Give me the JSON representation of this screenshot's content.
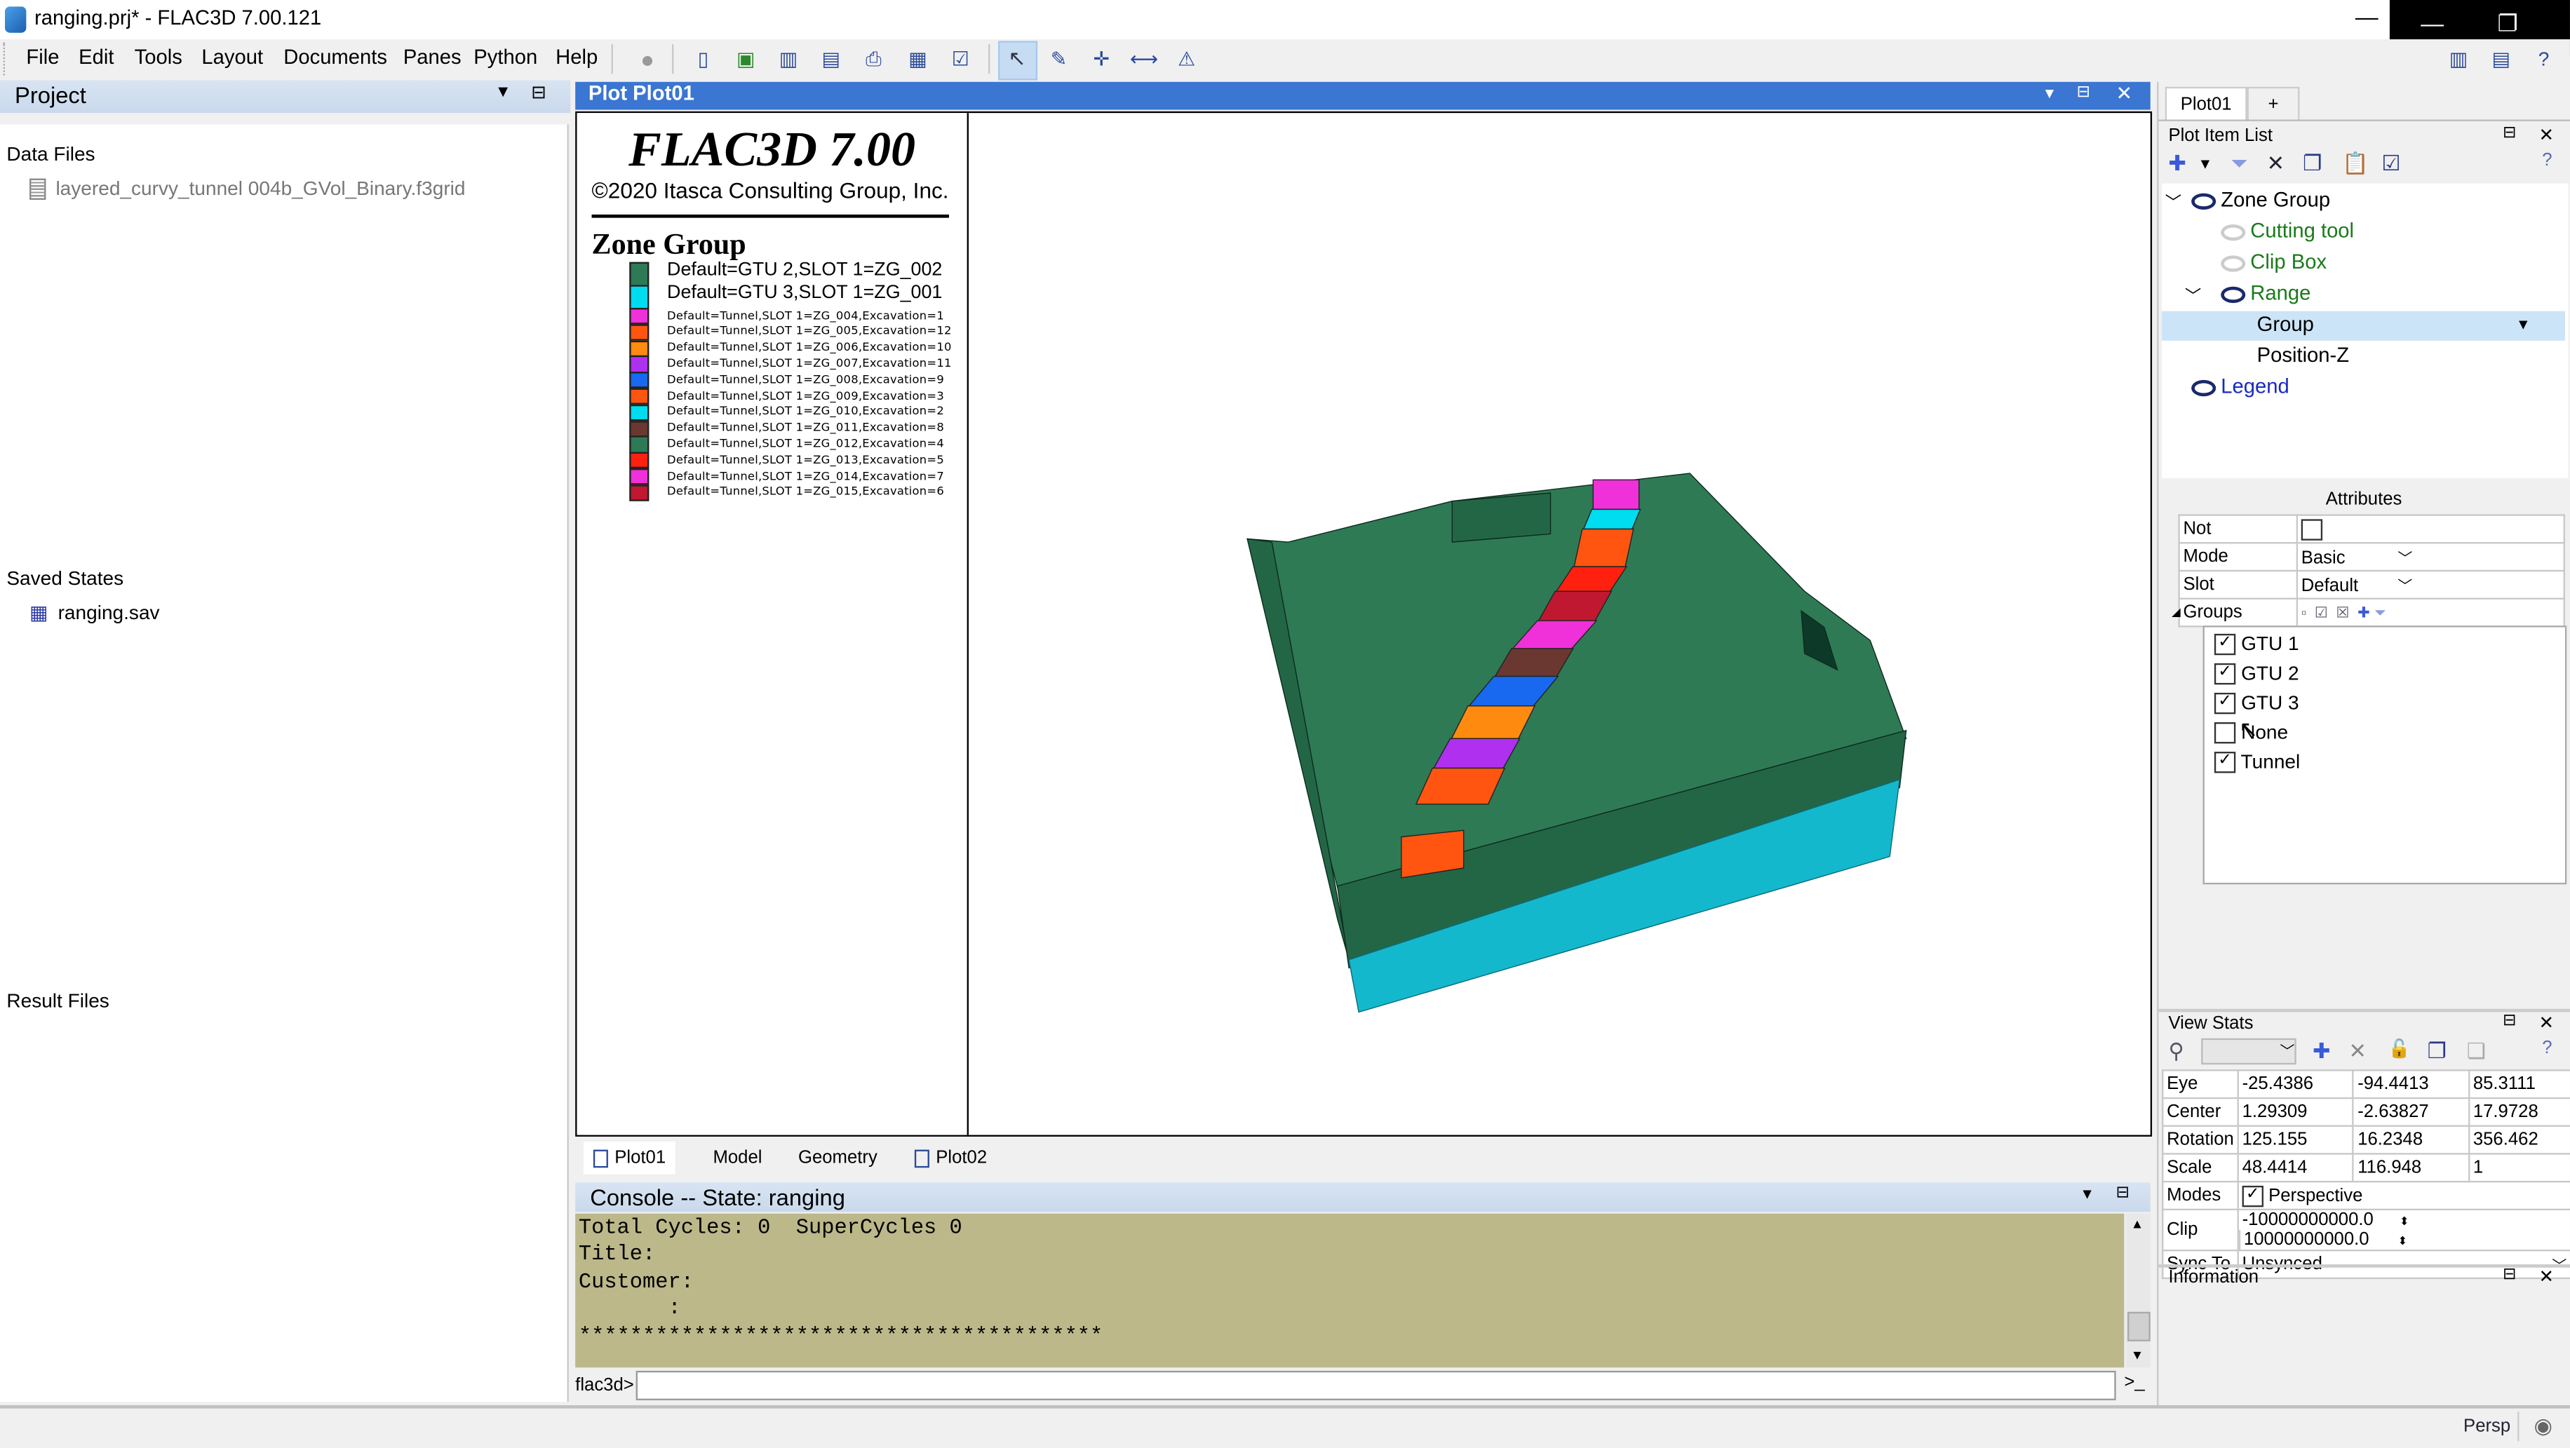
{
  "window": {
    "title": "ranging.prj* - FLAC3D 7.00.121",
    "controls": {
      "minimize": "—",
      "minimize_dark": "—",
      "restore": "❐"
    }
  },
  "menu": [
    "File",
    "Edit",
    "Tools",
    "Layout",
    "Documents",
    "Panes",
    "Python",
    "Help"
  ],
  "toolbar": {
    "icons": [
      "record-icon",
      "plot-new-icon",
      "plot-refresh-icon",
      "plot-save-icon",
      "plot-export-icon",
      "print-icon",
      "plot-dropdown-icon",
      "plot-check-icon",
      "select-pointer-icon",
      "pick-icon",
      "crosshair-icon",
      "ruler-icon",
      "axes-icon"
    ],
    "active": "select-pointer-icon",
    "right_icons": [
      "layout-icon",
      "layout-menu-icon",
      "layout-help-icon"
    ]
  },
  "project_panel": {
    "title": "Project",
    "sections": {
      "data_files": {
        "label": "Data Files",
        "items": [
          "layered_curvy_tunnel 004b_GVol_Binary.f3grid"
        ]
      },
      "saved_states": {
        "label": "Saved States",
        "items": [
          "ranging.sav"
        ]
      },
      "result_files": {
        "label": "Result Files",
        "items": []
      }
    }
  },
  "plot": {
    "title": "Plot Plot01",
    "legend": {
      "app_title": "FLAC3D 7.00",
      "copyright": "©2020 Itasca Consulting Group, Inc.",
      "heading": "Zone Group",
      "entries": [
        {
          "label": "Default=GTU 2,SLOT 1=ZG_002",
          "color": "#2e7a55",
          "size": "big"
        },
        {
          "label": "Default=GTU 3,SLOT 1=ZG_001",
          "color": "#00dcf0",
          "size": "big"
        },
        {
          "label": "Default=Tunnel,SLOT 1=ZG_004,Excavation=1",
          "color": "#f030d8",
          "size": "small"
        },
        {
          "label": "Default=Tunnel,SLOT 1=ZG_005,Excavation=12",
          "color": "#ff5510",
          "size": "small"
        },
        {
          "label": "Default=Tunnel,SLOT 1=ZG_006,Excavation=10",
          "color": "#ff8a10",
          "size": "small"
        },
        {
          "label": "Default=Tunnel,SLOT 1=ZG_007,Excavation=11",
          "color": "#b030f0",
          "size": "small"
        },
        {
          "label": "Default=Tunnel,SLOT 1=ZG_008,Excavation=9",
          "color": "#1868f0",
          "size": "small"
        },
        {
          "label": "Default=Tunnel,SLOT 1=ZG_009,Excavation=3",
          "color": "#ff5510",
          "size": "small"
        },
        {
          "label": "Default=Tunnel,SLOT 1=ZG_010,Excavation=2",
          "color": "#00dcf0",
          "size": "small"
        },
        {
          "label": "Default=Tunnel,SLOT 1=ZG_011,Excavation=8",
          "color": "#6a3830",
          "size": "small"
        },
        {
          "label": "Default=Tunnel,SLOT 1=ZG_012,Excavation=4",
          "color": "#2e7a55",
          "size": "small"
        },
        {
          "label": "Default=Tunnel,SLOT 1=ZG_013,Excavation=5",
          "color": "#ff2010",
          "size": "small"
        },
        {
          "label": "Default=Tunnel,SLOT 1=ZG_014,Excavation=7",
          "color": "#f030d8",
          "size": "small"
        },
        {
          "label": "Default=Tunnel,SLOT 1=ZG_015,Excavation=6",
          "color": "#c01830",
          "size": "small"
        }
      ]
    },
    "model_colors": {
      "rock_top": "#2e7a55",
      "rock_side": "#236645",
      "base": "#14b8cc",
      "tunnel_segments": [
        "#f030d8",
        "#00dcf0",
        "#ff5510",
        "#ff2010",
        "#c01830",
        "#f030d8",
        "#6a3830",
        "#1868f0",
        "#ff8a10",
        "#b030f0",
        "#ff5510"
      ]
    }
  },
  "doc_tabs": [
    {
      "label": "Plot01",
      "icon": "plot-icon",
      "active": true
    },
    {
      "label": "Model",
      "icon": null,
      "active": false
    },
    {
      "label": "Geometry",
      "icon": null,
      "active": false
    },
    {
      "label": "Plot02",
      "icon": "plot-icon",
      "active": false
    }
  ],
  "console": {
    "title": "Console -- State: ranging",
    "lines": [
      "Total Cycles: 0  SuperCycles 0",
      "Title:",
      "Customer:",
      "       :",
      "*****************************************"
    ],
    "prompt": "flac3d>",
    "input_value": ""
  },
  "right_panel": {
    "tabs": [
      "Plot01",
      "+"
    ],
    "plot_item_list": {
      "title": "Plot Item List",
      "tree": [
        {
          "label": "Zone Group",
          "level": 0,
          "expanded": true,
          "visible": true,
          "color": "#000000"
        },
        {
          "label": "Cutting tool",
          "level": 1,
          "visible": false,
          "color": "#1a7a1a"
        },
        {
          "label": "Clip Box",
          "level": 1,
          "visible": false,
          "color": "#1a7a1a"
        },
        {
          "label": "Range",
          "level": 1,
          "expanded": true,
          "visible": true,
          "color": "#1a7a1a"
        },
        {
          "label": "Group",
          "level": 2,
          "selected": true,
          "color": "#000000"
        },
        {
          "label": "Position-Z",
          "level": 2,
          "color": "#000000"
        },
        {
          "label": "Legend",
          "level": 0,
          "visible": true,
          "color": "#1a2ac0"
        }
      ]
    },
    "attributes": {
      "title": "Attributes",
      "not_label": "Not",
      "not_checked": false,
      "mode_label": "Mode",
      "mode_value": "Basic",
      "slot_label": "Slot",
      "slot_value": "Default",
      "groups_label": "Groups",
      "groups": [
        {
          "label": "GTU 1",
          "checked": true
        },
        {
          "label": "GTU 2",
          "checked": true
        },
        {
          "label": "GTU 3",
          "checked": true
        },
        {
          "label": "None",
          "checked": false
        },
        {
          "label": "Tunnel",
          "checked": true
        }
      ]
    },
    "view_stats": {
      "title": "View Stats",
      "rows": [
        {
          "label": "Eye",
          "values": [
            "-25.4386",
            "-94.4413",
            "85.3111"
          ]
        },
        {
          "label": "Center",
          "values": [
            "1.29309",
            "-2.63827",
            "17.9728"
          ]
        },
        {
          "label": "Rotation",
          "values": [
            "125.155",
            "16.2348",
            "356.462"
          ]
        },
        {
          "label": "Scale",
          "values": [
            "48.4414",
            "116.948",
            "1"
          ]
        }
      ],
      "modes_label": "Modes",
      "perspective_label": "Perspective",
      "perspective_checked": true,
      "clip_label": "Clip",
      "clip_min": "-10000000000.0",
      "clip_max": "10000000000.0",
      "sync_label": "Sync To",
      "sync_value": "Unsynced"
    },
    "information": {
      "title": "Information"
    }
  },
  "status_bar": {
    "mode": "Persp"
  }
}
